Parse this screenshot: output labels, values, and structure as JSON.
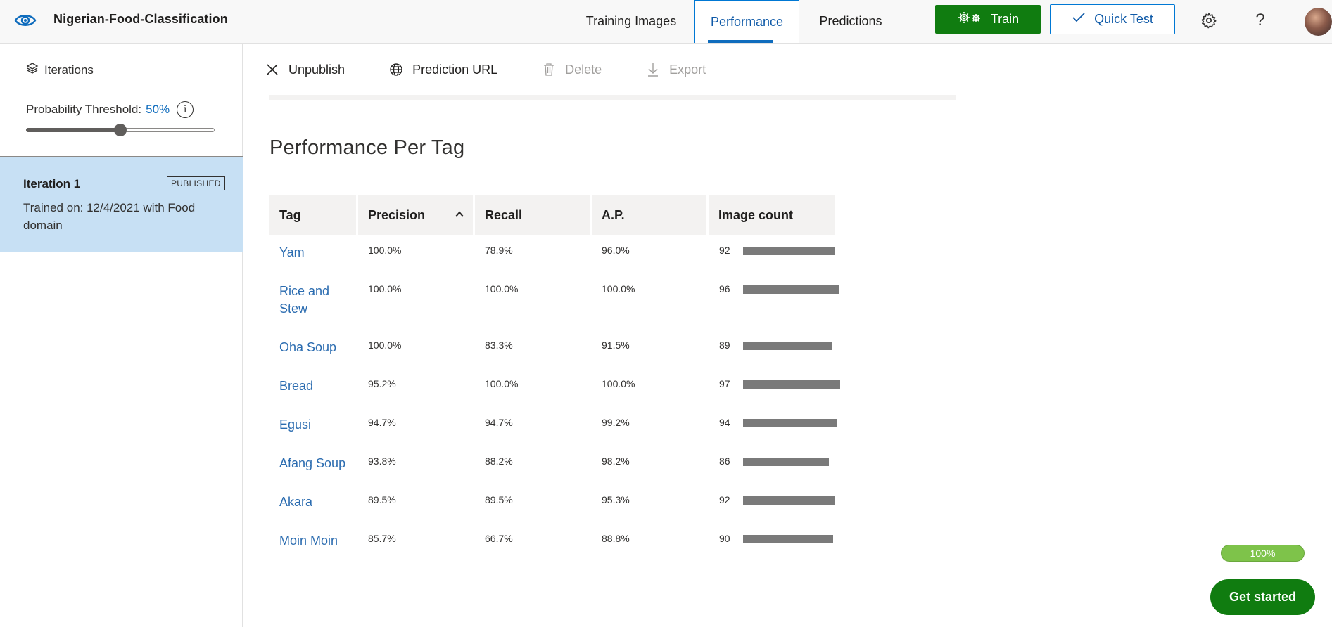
{
  "header": {
    "app_title": "Nigerian-Food-Classification",
    "tabs": [
      {
        "label": "Training Images"
      },
      {
        "label": "Performance"
      },
      {
        "label": "Predictions"
      }
    ],
    "train_label": "Train",
    "quick_test_label": "Quick Test",
    "help_label": "?"
  },
  "sidebar": {
    "iterations_label": "Iterations",
    "threshold_label": "Probability Threshold:",
    "threshold_value": "50%",
    "threshold_fraction": 0.5,
    "info_label": "i",
    "iteration": {
      "name": "Iteration 1",
      "badge": "PUBLISHED",
      "description": "Trained on: 12/4/2021 with Food domain"
    }
  },
  "toolbar": {
    "unpublish": "Unpublish",
    "prediction_url": "Prediction URL",
    "delete": "Delete",
    "export": "Export"
  },
  "section_title": "Performance Per Tag",
  "table": {
    "columns": [
      "Tag",
      "Precision",
      "Recall",
      "A.P.",
      "Image count"
    ],
    "sort_column": "Precision",
    "rows": [
      {
        "tag": "Yam",
        "precision": "100.0%",
        "recall": "78.9%",
        "ap": "96.0%",
        "count": "92",
        "count_value": 92
      },
      {
        "tag": "Rice and Stew",
        "precision": "100.0%",
        "recall": "100.0%",
        "ap": "100.0%",
        "count": "96",
        "count_value": 96
      },
      {
        "tag": "Oha Soup",
        "precision": "100.0%",
        "recall": "83.3%",
        "ap": "91.5%",
        "count": "89",
        "count_value": 89
      },
      {
        "tag": "Bread",
        "precision": "95.2%",
        "recall": "100.0%",
        "ap": "100.0%",
        "count": "97",
        "count_value": 97
      },
      {
        "tag": "Egusi",
        "precision": "94.7%",
        "recall": "94.7%",
        "ap": "99.2%",
        "count": "94",
        "count_value": 94
      },
      {
        "tag": "Afang Soup",
        "precision": "93.8%",
        "recall": "88.2%",
        "ap": "98.2%",
        "count": "86",
        "count_value": 86
      },
      {
        "tag": "Akara",
        "precision": "89.5%",
        "recall": "89.5%",
        "ap": "95.3%",
        "count": "92",
        "count_value": 92
      },
      {
        "tag": "Moin Moin",
        "precision": "85.7%",
        "recall": "66.7%",
        "ap": "88.8%",
        "count": "90",
        "count_value": 90
      }
    ]
  },
  "footer": {
    "progress_label": "100%",
    "progress_fraction": 1.0,
    "get_started_label": "Get started"
  },
  "colors": {
    "accent": "#0f6cbd",
    "train_green": "#107c10",
    "selected_iteration": "#c7e0f4",
    "bar_gray": "#7a7a7a"
  },
  "icons": [
    "eye-icon",
    "train-gears-icon",
    "check-icon",
    "gear-icon",
    "layers-icon",
    "info-icon",
    "close-icon",
    "globe-icon",
    "trash-icon",
    "download-icon",
    "sort-up-icon"
  ]
}
